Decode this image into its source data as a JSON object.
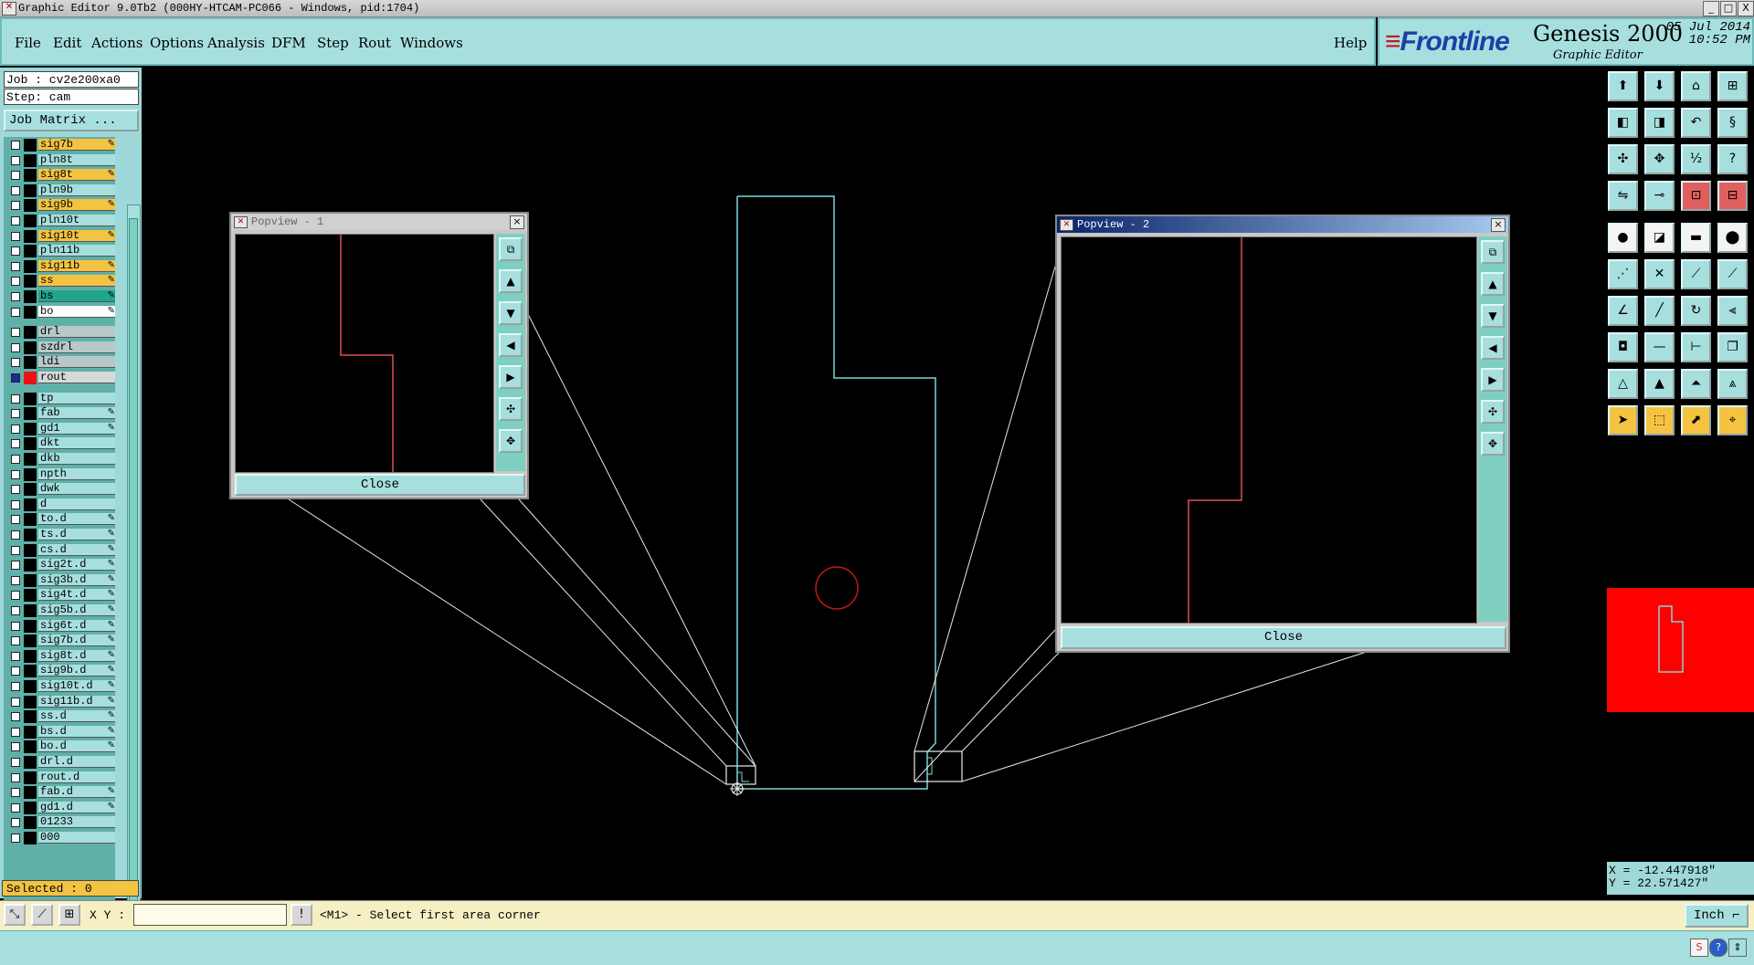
{
  "window": {
    "title": "Graphic Editor 9.0Tb2 (000HY-HTCAM-PC066 - Windows, pid:1704)",
    "icon": "app-icon",
    "controls": [
      "_",
      "□",
      "X"
    ]
  },
  "menu": {
    "items": [
      "File",
      "Edit",
      "Actions",
      "Options",
      "Analysis",
      "DFM",
      "Step",
      "Rout",
      "Windows"
    ],
    "help": "Help"
  },
  "brand": {
    "logo": "Frontline",
    "product": "Genesis 2000",
    "subtitle": "Graphic Editor",
    "date": "05 Jul 2014",
    "time": "10:52 PM"
  },
  "job": {
    "job_label": "Job : cv2e200xa0",
    "step_label": "Step: cam",
    "matrix_button": "Job Matrix ..."
  },
  "layers": [
    {
      "name": "sig7b",
      "color": "#f5c342",
      "editable": true
    },
    {
      "name": "pln8t",
      "color": "#a7dfdf",
      "editable": false
    },
    {
      "name": "sig8t",
      "color": "#f5c342",
      "editable": true
    },
    {
      "name": "pln9b",
      "color": "#a7dfdf",
      "editable": false
    },
    {
      "name": "sig9b",
      "color": "#f5c342",
      "editable": true
    },
    {
      "name": "pln10t",
      "color": "#a7dfdf",
      "editable": false
    },
    {
      "name": "sig10t",
      "color": "#f5c342",
      "editable": true
    },
    {
      "name": "pln11b",
      "color": "#a7dfdf",
      "editable": false
    },
    {
      "name": "sig11b",
      "color": "#f5c342",
      "editable": true
    },
    {
      "name": "ss",
      "color": "#f5c342",
      "editable": true
    },
    {
      "name": "bs",
      "color": "#1fa58a",
      "editable": true
    },
    {
      "name": "bo",
      "color": "#ffffff",
      "editable": true
    },
    {
      "name": "drl",
      "color": "#b8c8c8",
      "editable": false
    },
    {
      "name": "szdrl",
      "color": "#b8c8c8",
      "editable": false
    },
    {
      "name": "ldi",
      "color": "#b8c8c8",
      "editable": false
    },
    {
      "name": "rout",
      "color": "#d8d8d8",
      "editable": false,
      "active": true
    },
    {
      "name": "tp",
      "color": "#a7dfdf",
      "editable": false
    },
    {
      "name": "fab",
      "color": "#a7dfdf",
      "editable": true
    },
    {
      "name": "gd1",
      "color": "#a7dfdf",
      "editable": true
    },
    {
      "name": "dkt",
      "color": "#a7dfdf",
      "editable": false
    },
    {
      "name": "dkb",
      "color": "#a7dfdf",
      "editable": false
    },
    {
      "name": "npth",
      "color": "#a7dfdf",
      "editable": false
    },
    {
      "name": "dwk",
      "color": "#a7dfdf",
      "editable": false
    },
    {
      "name": "d",
      "color": "#a7dfdf",
      "editable": false
    },
    {
      "name": "to.d",
      "color": "#a7dfdf",
      "editable": true
    },
    {
      "name": "ts.d",
      "color": "#a7dfdf",
      "editable": true
    },
    {
      "name": "cs.d",
      "color": "#a7dfdf",
      "editable": true
    },
    {
      "name": "sig2t.d",
      "color": "#a7dfdf",
      "editable": true
    },
    {
      "name": "sig3b.d",
      "color": "#a7dfdf",
      "editable": true
    },
    {
      "name": "sig4t.d",
      "color": "#a7dfdf",
      "editable": true
    },
    {
      "name": "sig5b.d",
      "color": "#a7dfdf",
      "editable": true
    },
    {
      "name": "sig6t.d",
      "color": "#a7dfdf",
      "editable": true
    },
    {
      "name": "sig7b.d",
      "color": "#a7dfdf",
      "editable": true
    },
    {
      "name": "sig8t.d",
      "color": "#a7dfdf",
      "editable": true
    },
    {
      "name": "sig9b.d",
      "color": "#a7dfdf",
      "editable": true
    },
    {
      "name": "sig10t.d",
      "color": "#a7dfdf",
      "editable": true
    },
    {
      "name": "sig11b.d",
      "color": "#a7dfdf",
      "editable": true
    },
    {
      "name": "ss.d",
      "color": "#a7dfdf",
      "editable": true
    },
    {
      "name": "bs.d",
      "color": "#a7dfdf",
      "editable": true
    },
    {
      "name": "bo.d",
      "color": "#a7dfdf",
      "editable": true
    },
    {
      "name": "drl.d",
      "color": "#a7dfdf",
      "editable": false
    },
    {
      "name": "rout.d",
      "color": "#a7dfdf",
      "editable": false
    },
    {
      "name": "fab.d",
      "color": "#a7dfdf",
      "editable": true
    },
    {
      "name": "gd1.d",
      "color": "#a7dfdf",
      "editable": true
    },
    {
      "name": "01233",
      "color": "#a7dfdf",
      "editable": false
    },
    {
      "name": "000",
      "color": "#a7dfdf",
      "editable": false
    }
  ],
  "selected_label": "Selected : 0",
  "popview1": {
    "title": "Popview - 1",
    "close_label": "Close",
    "close_x": "×"
  },
  "popview2": {
    "title": "Popview - 2",
    "close_label": "Close",
    "close_x": "×"
  },
  "coords": {
    "x": "X = -12.447918\"",
    "y": "Y = 22.571427\""
  },
  "bottom": {
    "xy_label": "X Y :",
    "xy_value": "",
    "prompt": "<M1> - Select first area corner",
    "units": "Inch"
  },
  "colors": {
    "outline": "#7fd6d6",
    "rout": "#e05050",
    "drill_circle": "#c01818",
    "leader": "#e8e8e8"
  }
}
